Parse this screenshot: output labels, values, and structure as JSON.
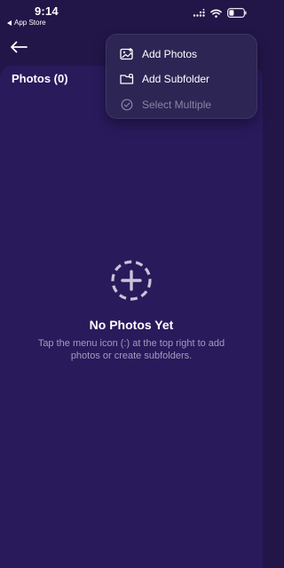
{
  "status_bar": {
    "time": "9:14",
    "back_app_label": "App Store"
  },
  "header": {
    "back_icon": "arrow-left-icon"
  },
  "photos_panel": {
    "title": "Photos (0)"
  },
  "menu": {
    "items": [
      {
        "label": "Add Photos",
        "icon": "photo-add-icon",
        "enabled": true
      },
      {
        "label": "Add Subfolder",
        "icon": "folder-add-icon",
        "enabled": true
      },
      {
        "label": "Select Multiple",
        "icon": "check-circle-icon",
        "enabled": false
      }
    ]
  },
  "empty_state": {
    "icon": "dashed-circle-plus-icon",
    "title": "No Photos Yet",
    "description": "Tap the menu icon (:) at the top right to add photos or create subfolders."
  },
  "colors": {
    "background": "#221648",
    "panel": "#291a5c",
    "menu_background": "#2d2554",
    "text_primary": "#ffffff",
    "text_secondary": "#a29cbc",
    "text_disabled": "#8a84a3"
  }
}
